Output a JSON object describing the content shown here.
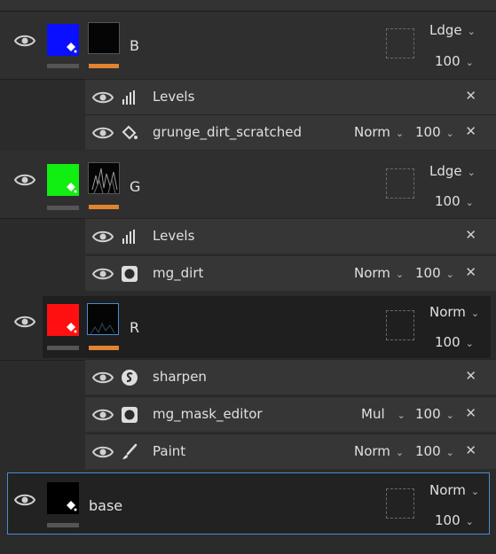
{
  "layers": [
    {
      "name": "B",
      "color": "#0a10ff",
      "blend_mode": "Ldge",
      "opacity": "100",
      "effects": [
        {
          "name": "Levels",
          "icon": "levels-icon",
          "blend_mode": "",
          "opacity": ""
        },
        {
          "name": "grunge_dirt_scratched",
          "icon": "fill-bucket-icon",
          "blend_mode": "Norm",
          "opacity": "100"
        }
      ]
    },
    {
      "name": "G",
      "color": "#11ee11",
      "blend_mode": "Ldge",
      "opacity": "100",
      "effects": [
        {
          "name": "Levels",
          "icon": "levels-icon",
          "blend_mode": "",
          "opacity": ""
        },
        {
          "name": "mg_dirt",
          "icon": "mask-generator-icon",
          "blend_mode": "Norm",
          "opacity": "100"
        }
      ]
    },
    {
      "name": "R",
      "color": "#ff0f0f",
      "blend_mode": "Norm",
      "opacity": "100",
      "effects": [
        {
          "name": "sharpen",
          "icon": "sharpen-icon",
          "blend_mode": "",
          "opacity": ""
        },
        {
          "name": "mg_mask_editor",
          "icon": "mask-generator-icon",
          "blend_mode": "Mul",
          "opacity": "100"
        },
        {
          "name": "Paint",
          "icon": "brush-icon",
          "blend_mode": "Norm",
          "opacity": "100"
        }
      ]
    },
    {
      "name": "base",
      "color": "#000000",
      "blend_mode": "Norm",
      "opacity": "100",
      "effects": []
    }
  ]
}
